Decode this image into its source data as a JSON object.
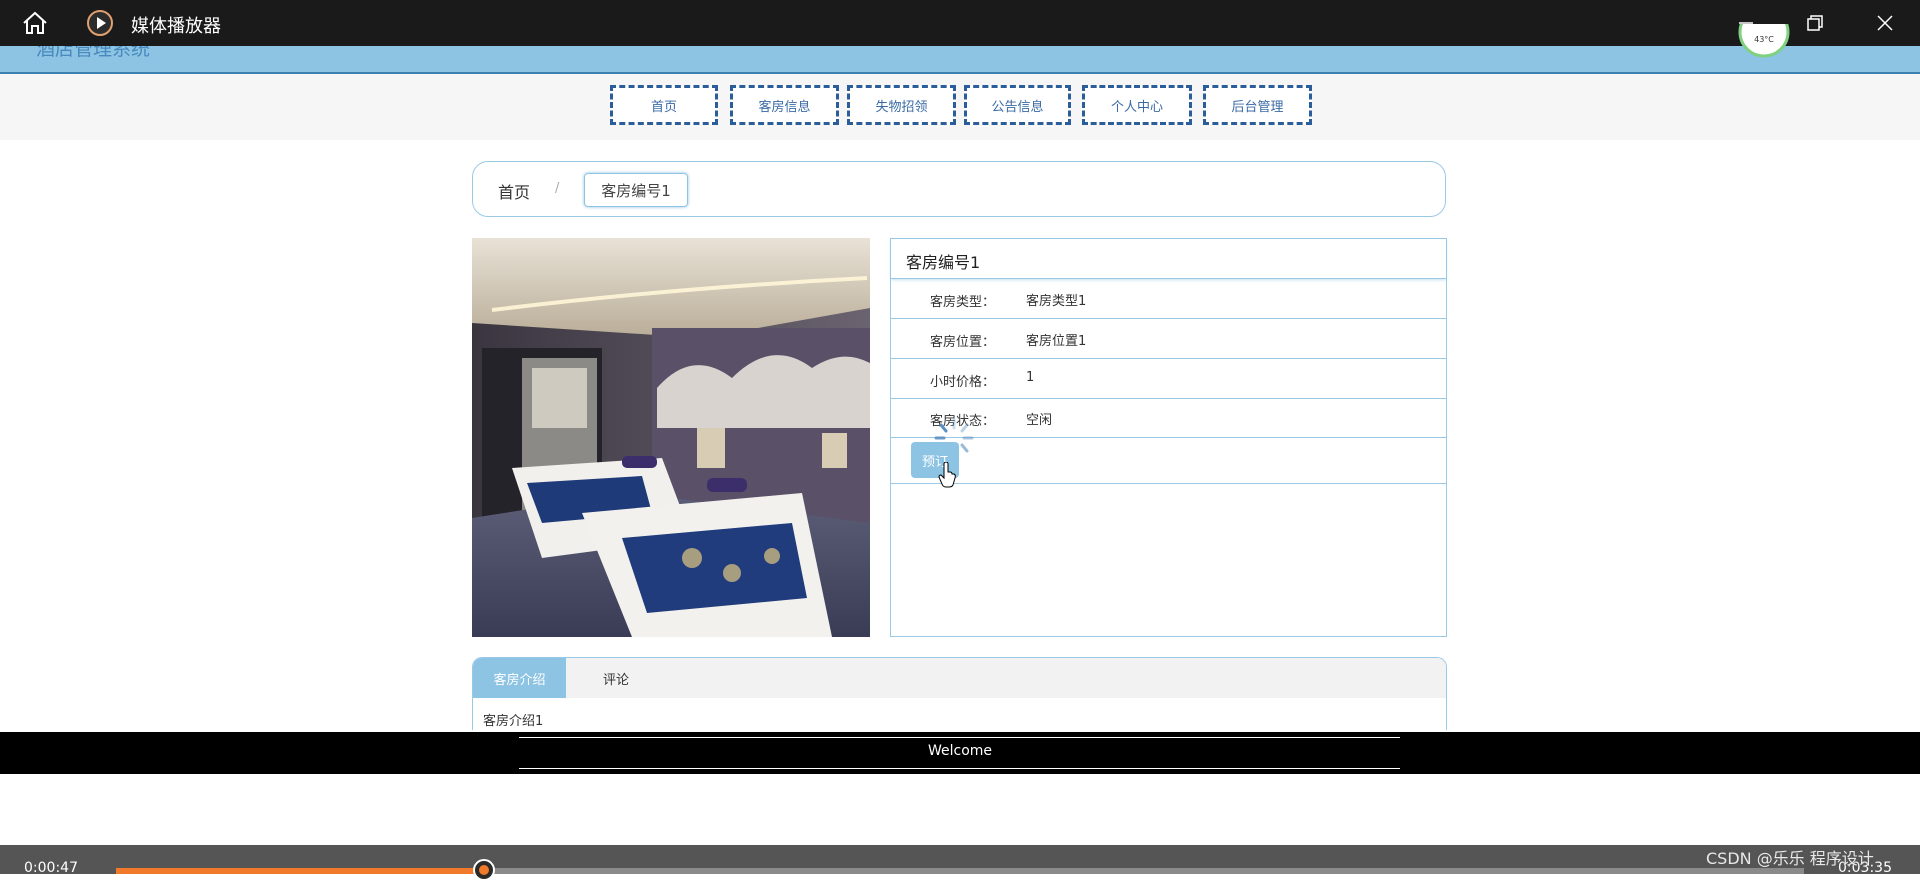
{
  "player": {
    "title": "媒体播放器",
    "current_time": "0:00:47",
    "total_time": "0:03:35",
    "progress": 0.218
  },
  "site": {
    "name": "酒店管理系统",
    "temperature": "43°C"
  },
  "nav": {
    "items": [
      "首页",
      "客房信息",
      "失物招领",
      "公告信息",
      "个人中心",
      "后台管理"
    ]
  },
  "breadcrumb": {
    "home": "首页",
    "separator": "/",
    "current": "客房编号1"
  },
  "room": {
    "title": "客房编号1",
    "fields": [
      {
        "label": "客房类型：",
        "value": "客房类型1"
      },
      {
        "label": "客房位置：",
        "value": "客房位置1"
      },
      {
        "label": "小时价格：",
        "value": "1"
      },
      {
        "label": "客房状态：",
        "value": "空闲"
      }
    ],
    "book_label": "预订"
  },
  "tabs": {
    "items": [
      "客房介绍",
      "评论"
    ],
    "active_content": "客房介绍1"
  },
  "footer": {
    "welcome": "Welcome"
  },
  "watermark": "CSDN @乐乐 程序设计",
  "colors": {
    "accent": "#8dc3e3",
    "nav_border": "#2a5d9a",
    "seek_progress": "#f07a2a"
  }
}
